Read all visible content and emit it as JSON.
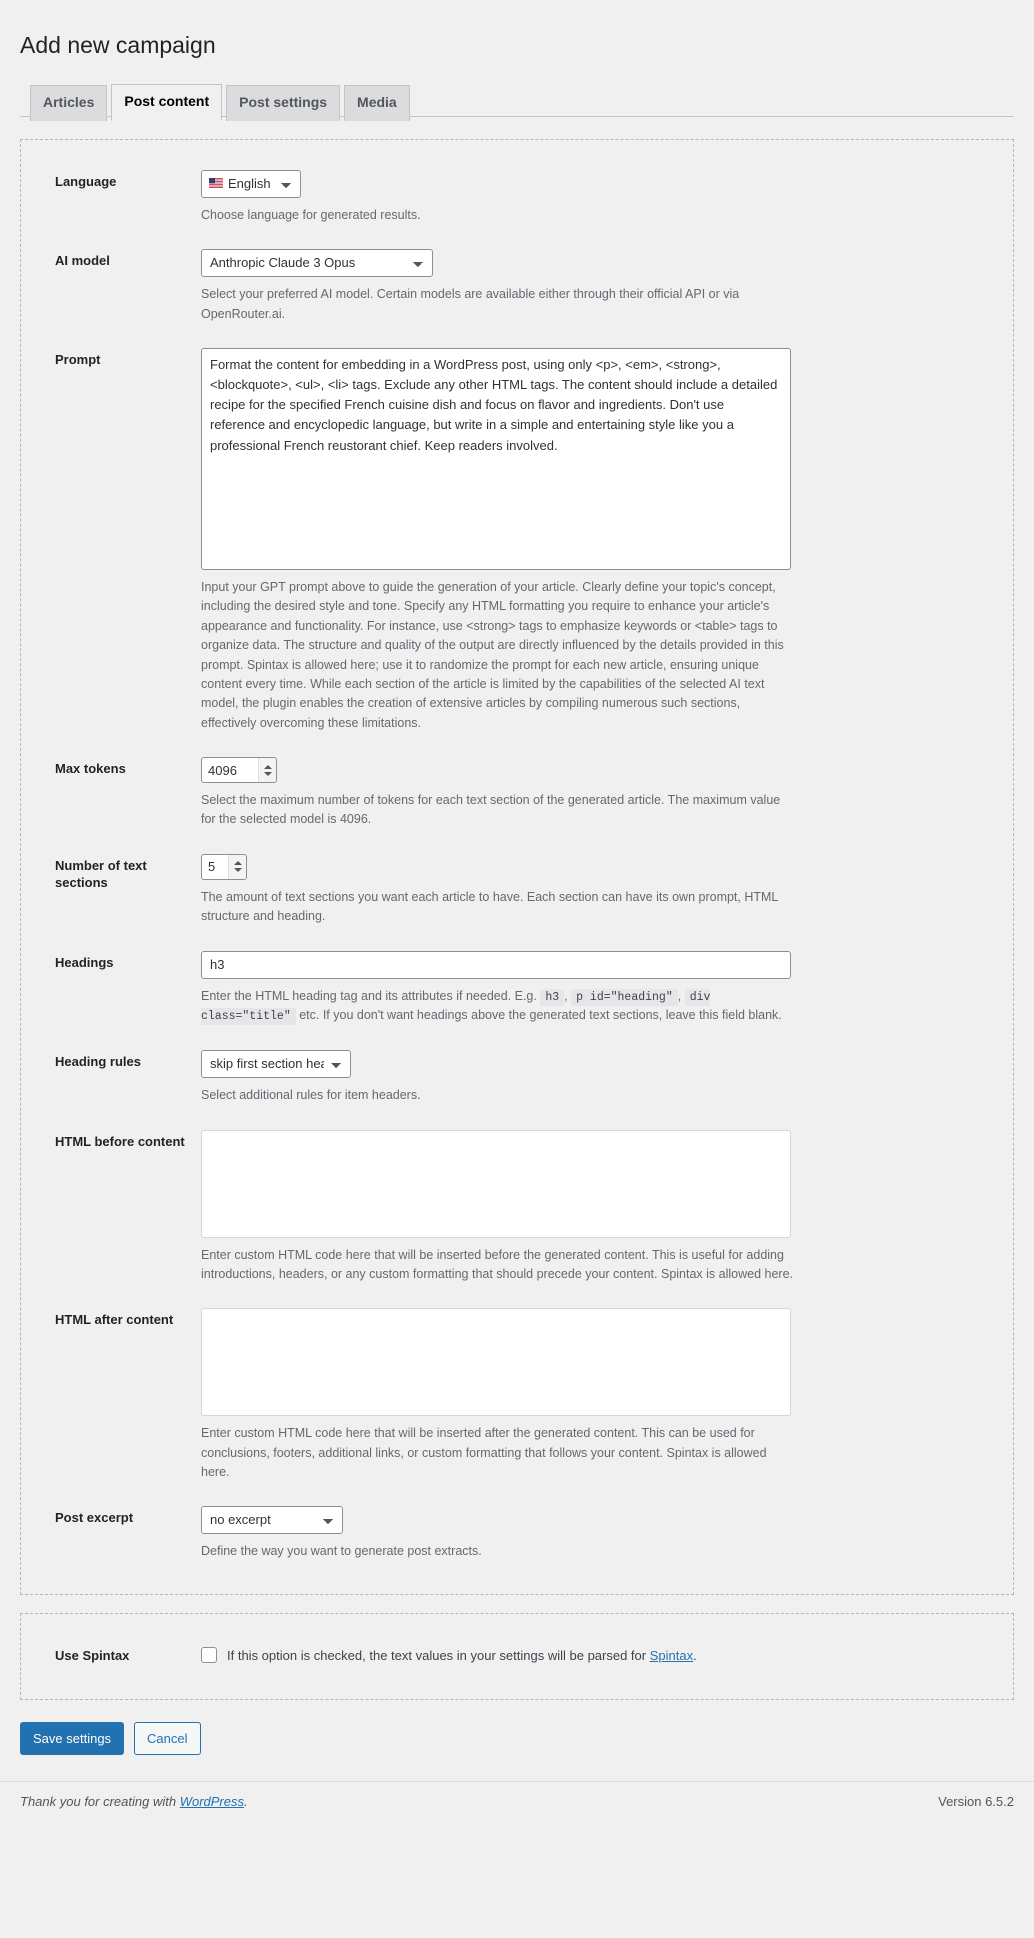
{
  "page": {
    "title": "Add new campaign"
  },
  "tabs": [
    {
      "label": "Articles",
      "active": false
    },
    {
      "label": "Post content",
      "active": true
    },
    {
      "label": "Post settings",
      "active": false
    },
    {
      "label": "Media",
      "active": false
    }
  ],
  "fields": {
    "language": {
      "label": "Language",
      "value": "English",
      "icon": "us-flag-icon",
      "desc": "Choose language for generated results."
    },
    "ai_model": {
      "label": "AI model",
      "value": "Anthropic Claude 3 Opus",
      "desc": "Select your preferred AI model. Certain models are available either through their official API or via OpenRouter.ai."
    },
    "prompt": {
      "label": "Prompt",
      "value": "Format the content for embedding in a WordPress post, using only <p>, <em>, <strong>, <blockquote>, <ul>, <li> tags. Exclude any other HTML tags. The content should include a detailed recipe for the specified French cuisine dish and focus on flavor and ingredients. Don't use reference and encyclopedic language, but write in a simple and entertaining style like you a professional French reustorant chief. Keep readers involved.",
      "desc": "Input your GPT prompt above to guide the generation of your article. Clearly define your topic's concept, including the desired style and tone. Specify any HTML formatting you require to enhance your article's appearance and functionality. For instance, use <strong> tags to emphasize keywords or <table> tags to organize data. The structure and quality of the output are directly influenced by the details provided in this prompt. Spintax is allowed here; use it to randomize the prompt for each new article, ensuring unique content every time. While each section of the article is limited by the capabilities of the selected AI text model, the plugin enables the creation of extensive articles by compiling numerous such sections, effectively overcoming these limitations."
    },
    "max_tokens": {
      "label": "Max tokens",
      "value": "4096",
      "desc": "Select the maximum number of tokens for each text section of the generated article. The maximum value for the selected model is 4096."
    },
    "text_sections": {
      "label": "Number of text sections",
      "value": "5",
      "desc": "The amount of text sections you want each article to have. Each section can have its own prompt, HTML structure and heading."
    },
    "headings": {
      "label": "Headings",
      "value": "h3",
      "desc_pre": "Enter the HTML heading tag and its attributes if needed. E.g.",
      "code1": "h3",
      "code2": "p id=\"heading\"",
      "code3": "div class=\"title\"",
      "desc_post": "etc. If you don't want headings above the generated text sections, leave this field blank."
    },
    "heading_rules": {
      "label": "Heading rules",
      "value": "skip first section heading",
      "desc": "Select additional rules for item headers."
    },
    "html_before": {
      "label": "HTML before content",
      "value": "",
      "desc": "Enter custom HTML code here that will be inserted before the generated content. This is useful for adding introductions, headers, or any custom formatting that should precede your content. Spintax is allowed here."
    },
    "html_after": {
      "label": "HTML after content",
      "value": "",
      "desc": "Enter custom HTML code here that will be inserted after the generated content. This can be used for conclusions, footers, additional links, or custom formatting that follows your content. Spintax is allowed here."
    },
    "post_excerpt": {
      "label": "Post excerpt",
      "value": "no excerpt",
      "desc": "Define the way you want to generate post extracts."
    },
    "use_spintax": {
      "label": "Use Spintax",
      "checked": false,
      "text_pre": "If this option is checked, the text values in your settings will be parsed for",
      "link": "Spintax",
      "text_post": "."
    }
  },
  "actions": {
    "save_label": "Save settings",
    "cancel_label": "Cancel"
  },
  "footer": {
    "thanks_pre": "Thank you for creating with",
    "thanks_link": "WordPress",
    "thanks_post": ".",
    "version": "Version 6.5.2"
  },
  "colors": {
    "accent": "#2271b1",
    "background": "#f0f0f1",
    "text": "#3c434a"
  }
}
